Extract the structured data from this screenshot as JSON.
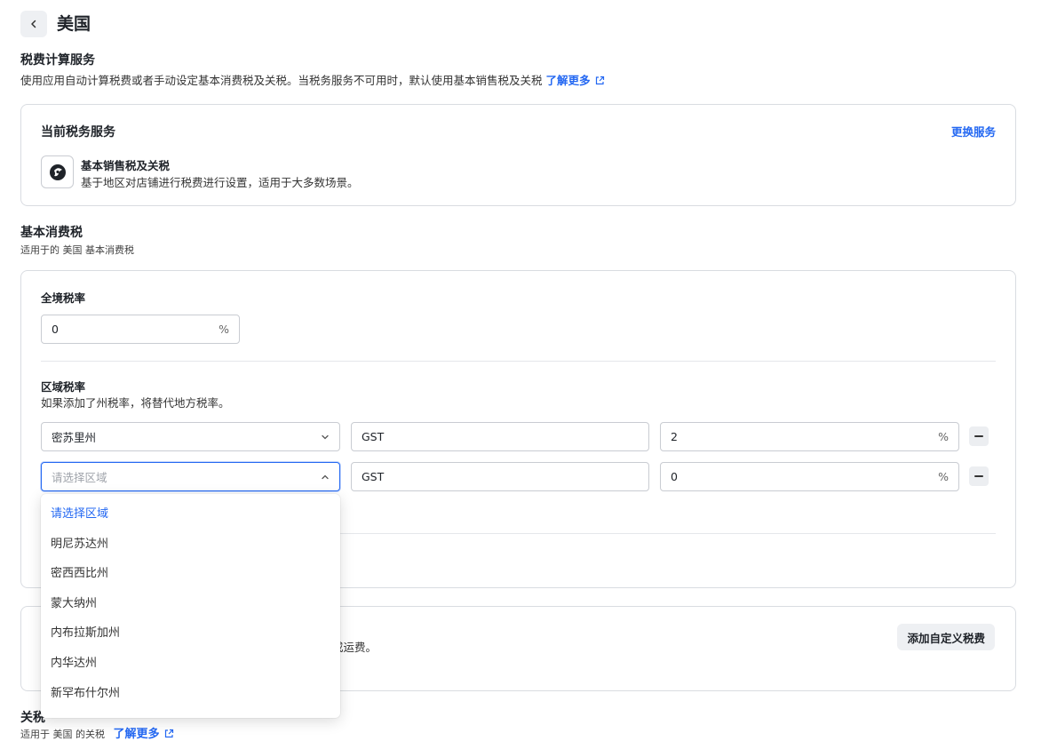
{
  "header": {
    "title": "美国",
    "back_icon": "chevron-left-icon"
  },
  "tax_service": {
    "title": "税费计算服务",
    "desc": "使用应用自动计算税费或者手动设定基本消费税及关税。当税务服务不可用时，默认使用基本销售税及关税",
    "learn_more": "了解更多"
  },
  "current_service": {
    "title": "当前税务服务",
    "change_label": "更换服务",
    "name": "基本销售税及关税",
    "desc": "基于地区对店铺进行税费进行设置，适用于大多数场景。"
  },
  "basic_tax": {
    "title": "基本消费税",
    "desc": "适用于的 美国 基本消费税",
    "nationwide": {
      "label": "全境税率",
      "value": "0",
      "suffix": "%"
    },
    "regional": {
      "label": "区域税率",
      "desc": "如果添加了州税率，将替代地方税率。",
      "rows": [
        {
          "region": "密苏里州",
          "name": "GST",
          "rate": "2",
          "suffix": "%"
        },
        {
          "region": "",
          "placeholder": "请选择区域",
          "name": "GST",
          "rate": "0",
          "suffix": "%"
        }
      ]
    }
  },
  "custom_tax": {
    "desc_fragment": "或运费。",
    "add_button": "添加自定义税费"
  },
  "duties": {
    "title": "关税",
    "desc": "适用于 美国 的关税",
    "learn_more": "了解更多"
  },
  "dropdown": {
    "options": [
      "请选择区域",
      "明尼苏达州",
      "密西西比州",
      "蒙大纳州",
      "内布拉斯加州",
      "内华达州",
      "新罕布什尔州"
    ],
    "selected_index": 0
  },
  "colors": {
    "accent": "#2468f2",
    "border": "#d9dce1"
  }
}
